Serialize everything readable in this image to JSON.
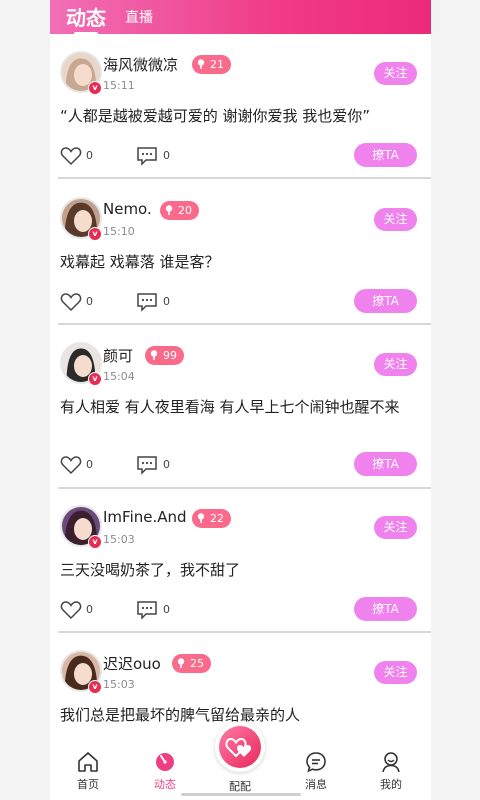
{
  "header": {
    "tab_active": "动态",
    "tab_other": "直播"
  },
  "posts": [
    {
      "name": "海风微微凉",
      "time": "15:11",
      "level": "21",
      "follow": "关注",
      "content": "“人都是越被爱越可爱的 谢谢你爱我 我也爱你”",
      "likes": "0",
      "comments": "0",
      "flirt": "撩TA",
      "verified": "v",
      "hair_color": "#c9a892"
    },
    {
      "name": "Nemo.",
      "time": "15:10",
      "level": "20",
      "follow": "关注",
      "content": "戏幕起 戏幕落 谁是客？",
      "likes": "0",
      "comments": "0",
      "flirt": "撩TA",
      "verified": "v",
      "hair_color": "#5a3b2b"
    },
    {
      "name": "颜可",
      "time": "15:04",
      "level": "99",
      "follow": "关注",
      "content": "有人相爱 有人夜里看海 有人早上七个闹钟也醒不来",
      "likes": "0",
      "comments": "0",
      "flirt": "撩TA",
      "verified": "v",
      "hair_color": "#2b2b2b"
    },
    {
      "name": "ImFine.And",
      "time": "15:03",
      "level": "22",
      "follow": "关注",
      "content": "三天没喝奶茶了，我不甜了",
      "likes": "0",
      "comments": "0",
      "flirt": "撩TA",
      "verified": "v",
      "hair_color": "#3a1f2e"
    },
    {
      "name": "迟迟ouo",
      "time": "15:03",
      "level": "25",
      "follow": "关注",
      "content": "我们总是把最坏的脾气留给最亲的人",
      "likes": "",
      "comments": "",
      "flirt": "",
      "verified": "v",
      "hair_color": "#4a2a1e"
    }
  ],
  "tabbar": {
    "home": "首页",
    "feed": "动态",
    "match": "配配",
    "messages": "消息",
    "mine": "我的"
  },
  "colors": {
    "header_start": "#f16fb6",
    "header_end": "#ec2a7a",
    "button": "#ef82ec",
    "level_badge": "#f96a8b",
    "verified_badge": "#e82b52",
    "active_tab": "#ec3f86"
  },
  "icons": {
    "like": "heart-outline-icon",
    "comment": "comment-bubble-icon",
    "home": "home-icon",
    "feed": "clock-dial-icon",
    "match": "double-heart-icon",
    "messages": "chat-lines-icon",
    "mine": "person-icon"
  }
}
